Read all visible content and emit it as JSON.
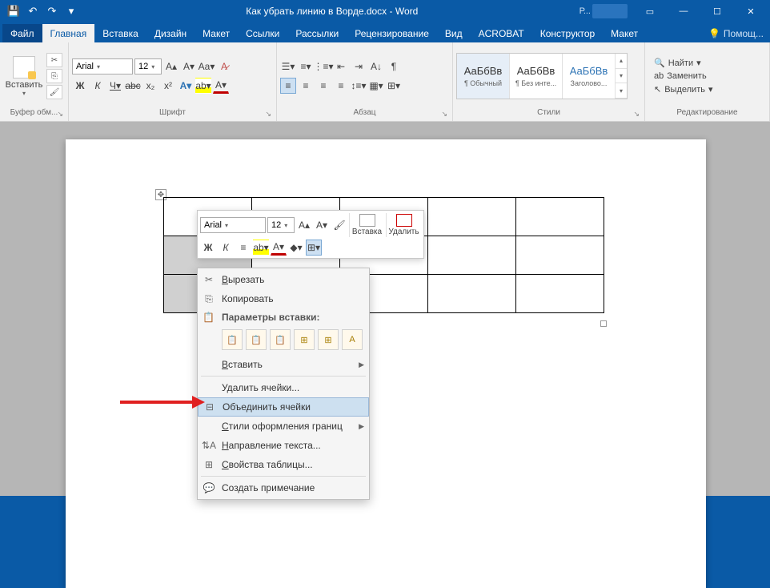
{
  "title": "Как убрать линию в Ворде.docx - Word",
  "account_hint": "Р...",
  "tabs": {
    "file": "Файл",
    "home": "Главная",
    "insert": "Вставка",
    "design": "Дизайн",
    "layout": "Макет",
    "references": "Ссылки",
    "mailings": "Рассылки",
    "review": "Рецензирование",
    "view": "Вид",
    "acrobat": "ACROBAT",
    "constructor": "Конструктор",
    "table_layout": "Макет"
  },
  "help": "Помощ...",
  "ribbon": {
    "clipboard": {
      "paste": "Вставить",
      "label": "Буфер обм..."
    },
    "font": {
      "name": "Arial",
      "size": "12",
      "label": "Шрифт"
    },
    "paragraph": {
      "label": "Абзац"
    },
    "styles": {
      "label": "Стили",
      "items": [
        "¶ Обычный",
        "¶ Без инте...",
        "Заголово..."
      ],
      "preview": "АаБбВв"
    },
    "editing": {
      "label": "Редактирование",
      "find": "Найти",
      "replace": "Заменить",
      "select": "Выделить"
    }
  },
  "minitool": {
    "font": "Arial",
    "size": "12",
    "insert": "Вставка",
    "delete": "Удалить"
  },
  "ctx": {
    "cut": "Вырезать",
    "copy": "Копировать",
    "paste_hdr": "Параметры вставки:",
    "paste_sub": "Вставить",
    "del_cells": "Удалить ячейки...",
    "merge": "Объединить ячейки",
    "border_styles": "Стили оформления границ",
    "text_dir": "Направление текста...",
    "table_props": "Свойства таблицы...",
    "comment": "Создать примечание"
  }
}
